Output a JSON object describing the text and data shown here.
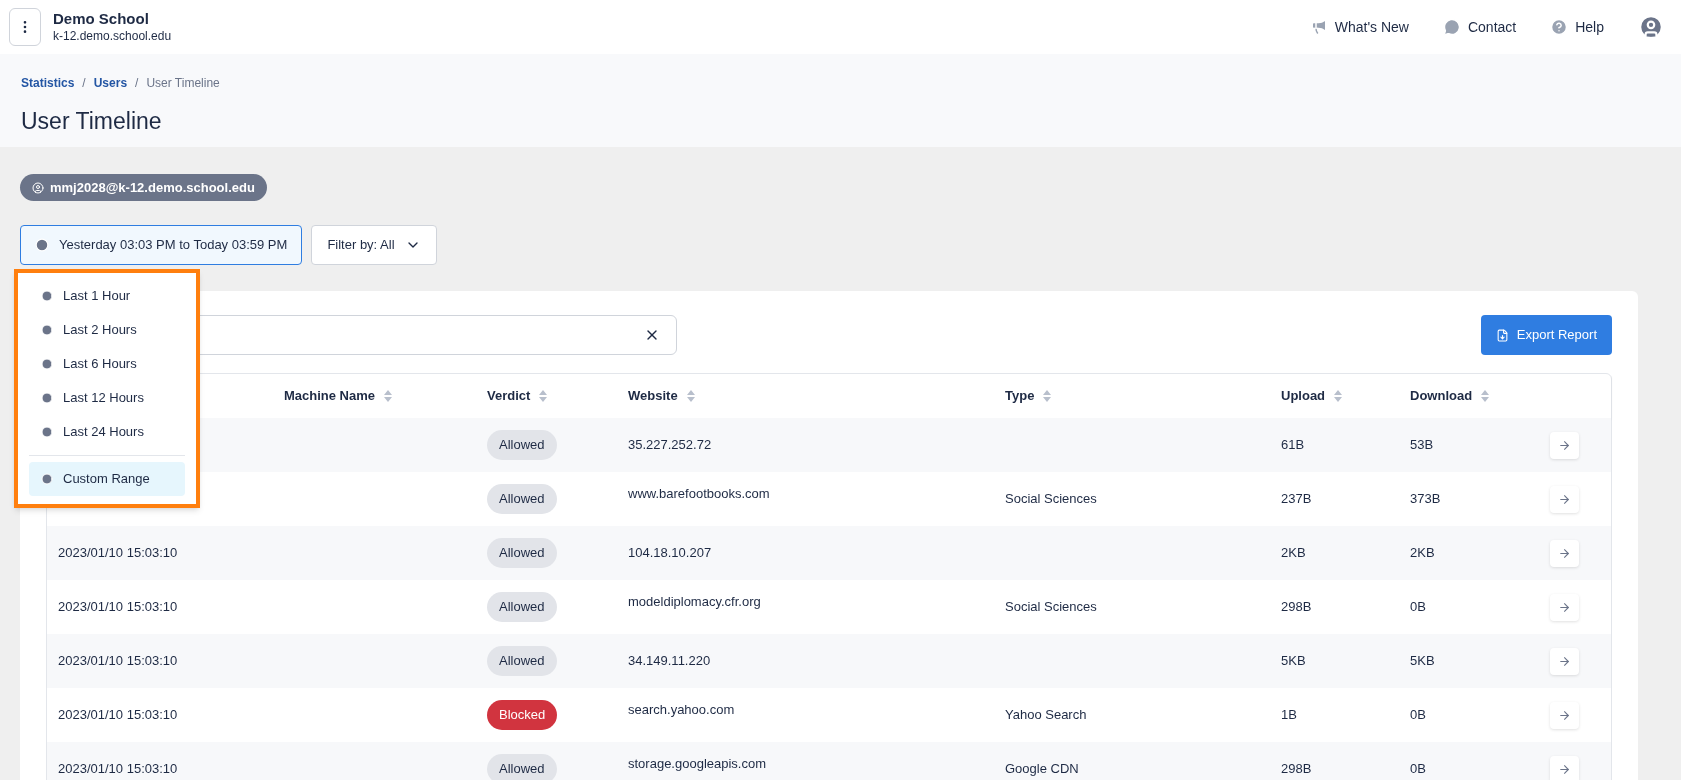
{
  "org": {
    "name": "Demo School",
    "domain": "k-12.demo.school.edu"
  },
  "top_links": [
    {
      "label": "What's New",
      "kind": "megaphone"
    },
    {
      "label": "Contact",
      "kind": "chat"
    },
    {
      "label": "Help",
      "kind": "help"
    }
  ],
  "breadcrumbs": [
    "Statistics",
    "Users",
    "User Timeline"
  ],
  "breadcrumb_separator": "/",
  "title": "User Timeline",
  "user_chip": "mmj2028@k-12.demo.school.edu",
  "date_range": {
    "label": "Yesterday 03:03 PM to Today 03:59 PM",
    "expanded": true
  },
  "filter": {
    "label": "Filter by: All"
  },
  "range_menu": [
    {
      "label": "Last 1 Hour",
      "selected": false
    },
    {
      "label": "Last 2 Hours",
      "selected": false
    },
    {
      "label": "Last 6 Hours",
      "selected": false
    },
    {
      "label": "Last 12 Hours",
      "selected": false
    },
    {
      "label": "Last 24 Hours",
      "selected": false
    },
    {
      "label": "Custom Range",
      "selected": true
    }
  ],
  "export_button": "Export Report",
  "columns": [
    "Machine Name",
    "Verdict",
    "Website",
    "Type",
    "Upload",
    "Download"
  ],
  "rows": [
    {
      "verdict": {
        "label": "Allowed",
        "kind": "allowed"
      },
      "website": "35.227.252.72",
      "upload": "61B",
      "download": "53B"
    },
    {
      "verdict": {
        "label": "Allowed",
        "kind": "allowed"
      },
      "website": "www.barefootbooks.com",
      "type": "Social Sciences",
      "upload": "237B",
      "download": "373B"
    },
    {
      "time": "2023/01/10 15:03:10",
      "verdict": {
        "label": "Allowed",
        "kind": "allowed"
      },
      "website": "104.18.10.207",
      "upload": "2KB",
      "download": "2KB"
    },
    {
      "time": "2023/01/10 15:03:10",
      "verdict": {
        "label": "Allowed",
        "kind": "allowed"
      },
      "website": "modeldiplomacy.cfr.org",
      "type": "Social Sciences",
      "upload": "298B",
      "download": "0B"
    },
    {
      "time": "2023/01/10 15:03:10",
      "verdict": {
        "label": "Allowed",
        "kind": "allowed"
      },
      "website": "34.149.11.220",
      "upload": "5KB",
      "download": "5KB"
    },
    {
      "time": "2023/01/10 15:03:10",
      "verdict": {
        "label": "Blocked",
        "kind": "blocked"
      },
      "website": "search.yahoo.com",
      "type": "Yahoo Search",
      "upload": "1B",
      "download": "0B"
    },
    {
      "time": "2023/01/10 15:03:10",
      "verdict": {
        "label": "Allowed",
        "kind": "allowed"
      },
      "website": "storage.googleapis.com",
      "type": "Google CDN",
      "upload": "298B",
      "download": "0B"
    }
  ]
}
